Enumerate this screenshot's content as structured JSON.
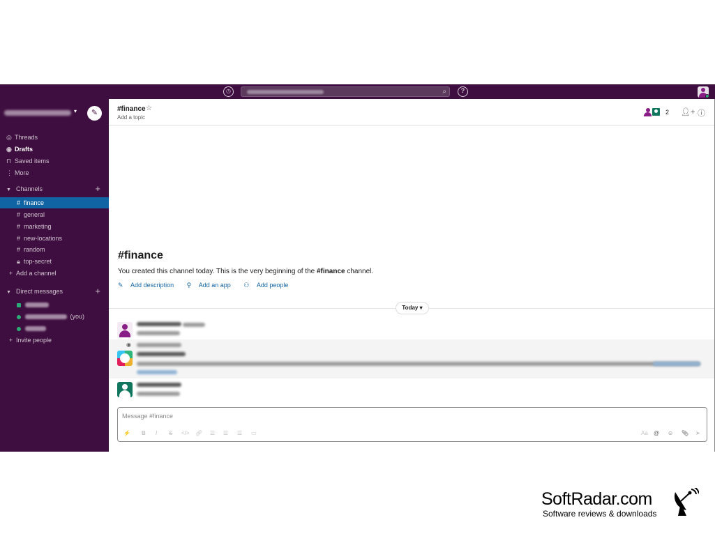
{
  "topbar": {
    "history_icon": "clock-icon",
    "search_icon": "search-icon",
    "help_icon": "help-icon"
  },
  "sidebar": {
    "nav": [
      {
        "label": "Threads",
        "icon": "threads-icon"
      },
      {
        "label": "Drafts",
        "icon": "drafts-icon"
      },
      {
        "label": "Saved items",
        "icon": "bookmark-icon"
      },
      {
        "label": "More",
        "icon": "more-icon"
      }
    ],
    "channels_header": "Channels",
    "channels": [
      "finance",
      "general",
      "marketing",
      "new-locations",
      "random",
      "top-secret"
    ],
    "active_channel": "finance",
    "add_channel": "Add a channel",
    "dm_header": "Direct messages",
    "dm_you_suffix": "(you)",
    "invite": "Invite people",
    "colors": {
      "bg": "#3f0e40",
      "active": "#1164a3",
      "presence": "#2bac76"
    }
  },
  "header": {
    "channel": "#finance",
    "topic": "Add a topic",
    "member_count": "2"
  },
  "intro": {
    "title": "#finance",
    "text_before": "You created this channel today. This is the very beginning of the ",
    "text_channel": "#finance",
    "text_after": " channel.",
    "add_description": "Add description",
    "add_app": "Add an app",
    "add_people": "Add people"
  },
  "divider": {
    "label": "Today"
  },
  "composer": {
    "placeholder": "Message #finance"
  },
  "watermark": {
    "title": "SoftRadar.com",
    "subtitle": "Software reviews & downloads"
  }
}
